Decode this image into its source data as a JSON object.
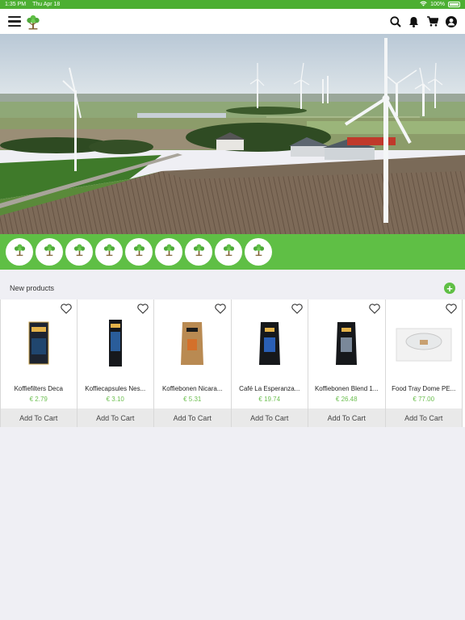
{
  "status_bar": {
    "time": "1:35 PM",
    "date": "Thu Apr 18",
    "battery": "100%"
  },
  "header": {
    "icons": [
      "menu-icon",
      "tree-logo",
      "search-icon",
      "bell-icon",
      "cart-icon",
      "user-icon"
    ]
  },
  "categories": {
    "count": 9,
    "icon": "tree-icon"
  },
  "new_products": {
    "title": "New products",
    "items": [
      {
        "name": "Koffiefilters Deca",
        "price": "€ 2.79",
        "button": "Add To Cart"
      },
      {
        "name": "Koffiecapsules Nes...",
        "price": "€ 3.10",
        "button": "Add To Cart"
      },
      {
        "name": "Koffiebonen Nicara...",
        "price": "€ 5.31",
        "button": "Add To Cart"
      },
      {
        "name": "Café La Esperanza...",
        "price": "€ 19.74",
        "button": "Add To Cart"
      },
      {
        "name": "Koffiebonen Blend 1...",
        "price": "€ 26.48",
        "button": "Add To Cart"
      },
      {
        "name": "Food Tray Dome PE...",
        "price": "€ 77.00",
        "button": "Add To Cart"
      }
    ]
  },
  "colors": {
    "brand_green": "#5fbf45",
    "status_green": "#4caf32",
    "price_green": "#6bbf4f"
  }
}
